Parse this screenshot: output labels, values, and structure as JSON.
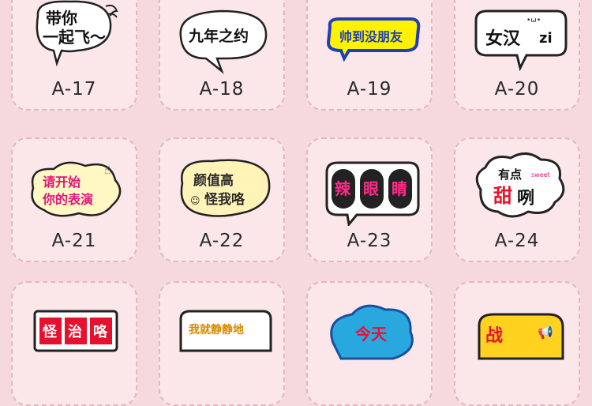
{
  "colors": {
    "background": "#f6d9dd",
    "card": "#fbe7ea",
    "card_border": "#e2b7bd"
  },
  "cards": [
    {
      "code": "A-17",
      "text": [
        "带你",
        "一起飞～"
      ]
    },
    {
      "code": "A-18",
      "text": [
        "九年之约"
      ]
    },
    {
      "code": "A-19",
      "text": [
        "帅到没朋友"
      ]
    },
    {
      "code": "A-20",
      "text": [
        "女汉",
        "zi"
      ]
    },
    {
      "code": "A-21",
      "text": [
        "请开始",
        "你的表演"
      ]
    },
    {
      "code": "A-22",
      "text": [
        "颜值高",
        "怪我咯"
      ]
    },
    {
      "code": "A-23",
      "text": [
        "辣",
        "眼",
        "睛"
      ]
    },
    {
      "code": "A-24",
      "text": [
        "有点",
        "sweet",
        "甜",
        "咧"
      ]
    },
    {
      "code": "",
      "text": [
        "怪",
        "治",
        "咯"
      ]
    },
    {
      "code": "",
      "text": [
        "我就静静地"
      ]
    },
    {
      "code": "",
      "text": [
        "今天"
      ]
    },
    {
      "code": "",
      "text": [
        "战"
      ]
    }
  ]
}
